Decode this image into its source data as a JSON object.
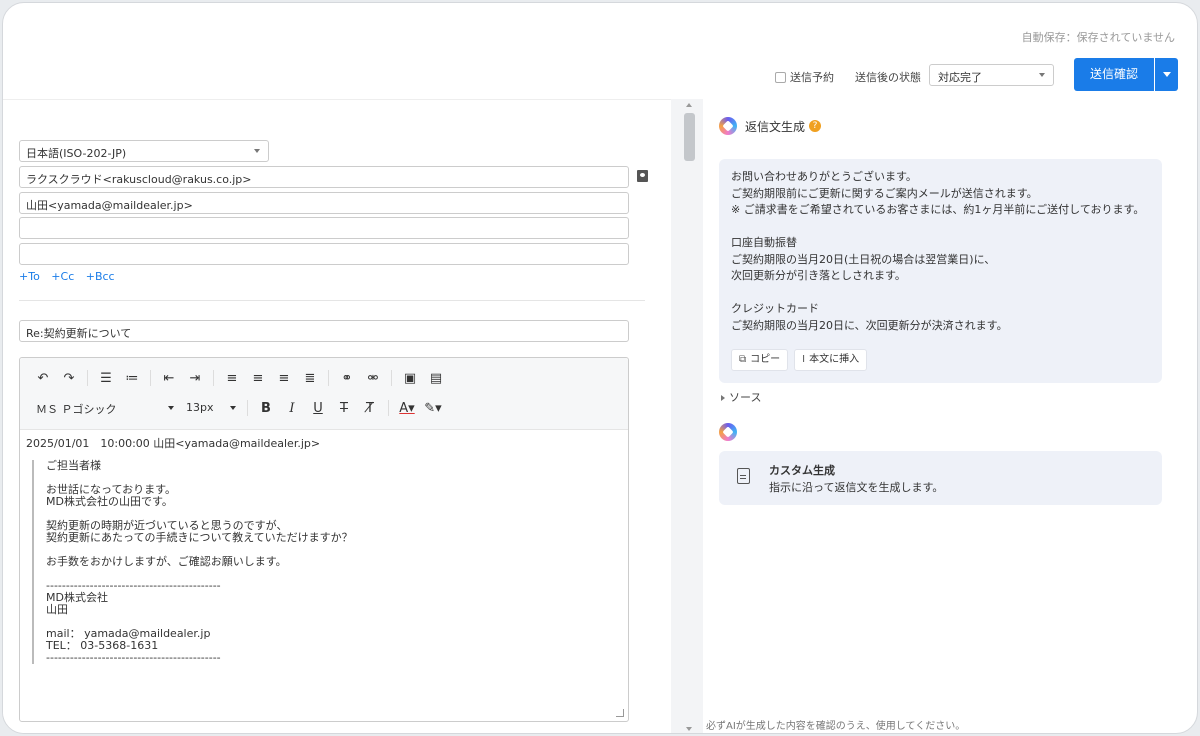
{
  "autosave": "自動保存：保存されていません",
  "topbar": {
    "scheduled_label": "送信予約",
    "after_status_label": "送信後の状態",
    "status_value": "対応完了",
    "send_label": "送信確認"
  },
  "compose": {
    "encoding": "日本語(ISO-202-JP)",
    "from": "ラクスクラウド<rakuscloud@rakus.co.jp>",
    "to": "山田<yamada@maildealer.jp>",
    "cc": "",
    "bcc": "",
    "add_to": "+To",
    "add_cc": "+Cc",
    "add_bcc": "+Bcc",
    "subject": "Re:契約更新について"
  },
  "editor": {
    "font": "ＭＳ Ｐゴシック",
    "size": "13px",
    "quote_header": "2025/01/01　10:00:00 山田<yamada@maildealer.jp>",
    "quote_lines": [
      "ご担当者様",
      "",
      "お世話になっております。",
      "MD株式会社の山田です。",
      "",
      "契約更新の時期が近づいていると思うのですが、",
      "契約更新にあたっての手続きについて教えていただけますか？",
      "",
      "お手数をおかけしますが、ご確認お願いします。",
      "",
      "--------------------------------------------",
      "MD株式会社",
      "山田",
      "",
      "mail： yamada@maildealer.jp",
      "TEL： 03-5368-1631",
      "--------------------------------------------"
    ]
  },
  "ai_panel": {
    "title": "返信文生成",
    "generated_lines": [
      "お問い合わせありがとうございます。",
      "ご契約期限前にご更新に関するご案内メールが送信されます。",
      "※ ご請求書をご希望されているお客さまには、約1ヶ月半前にご送付しております。",
      "",
      "口座自動振替",
      "ご契約期限の当月20日(土日祝の場合は翌営業日)に、",
      "次回更新分が引き落としされます。",
      "",
      "クレジットカード",
      "ご契約期限の当月20日に、次回更新分が決済されます。"
    ],
    "copy_label": "コピー",
    "insert_label": "本文に挿入",
    "source_label": "ソース",
    "custom_title": "カスタム生成",
    "custom_desc": "指示に沿って返信文を生成します。",
    "footnote": "必ずAIが生成した内容を確認のうえ、使用してください。"
  },
  "colors": {
    "accent": "#1a7ce8",
    "panel_bg": "#eef1f8"
  }
}
